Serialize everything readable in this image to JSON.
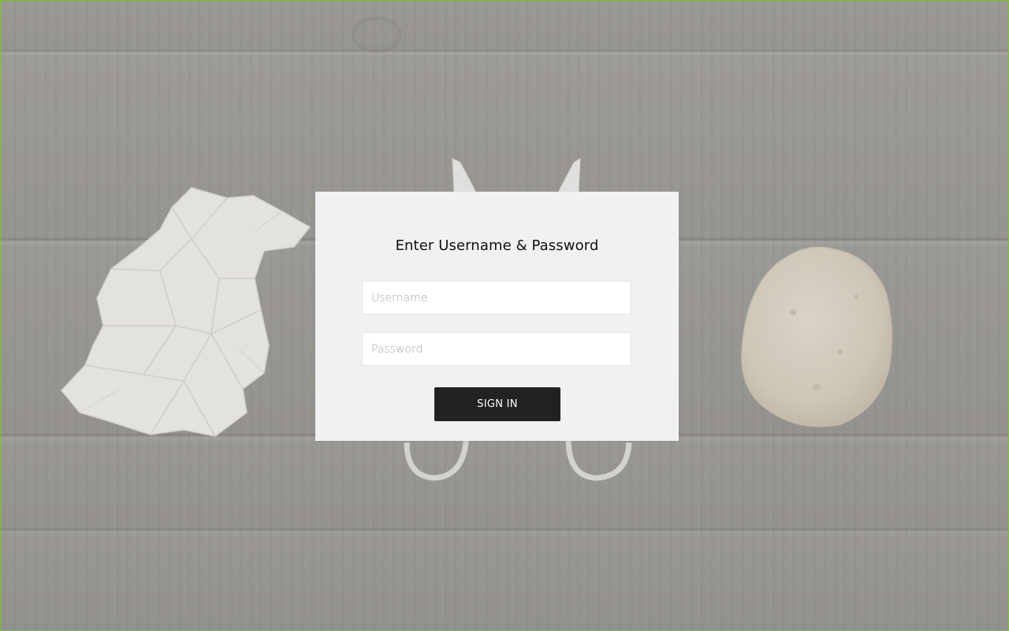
{
  "login": {
    "title": "Enter Username & Password",
    "username_placeholder": "Username",
    "password_placeholder": "Password",
    "username_value": "",
    "password_value": "",
    "signin_label": "SIGN IN"
  },
  "theme": {
    "card_background": "#f1f1f1",
    "button_background": "#222222",
    "button_text": "#ffffff",
    "page_border": "#7bbf3a"
  },
  "decor": [
    "crumpled-paper-image",
    "scissors-image",
    "rock-image",
    "wood-background-image"
  ]
}
